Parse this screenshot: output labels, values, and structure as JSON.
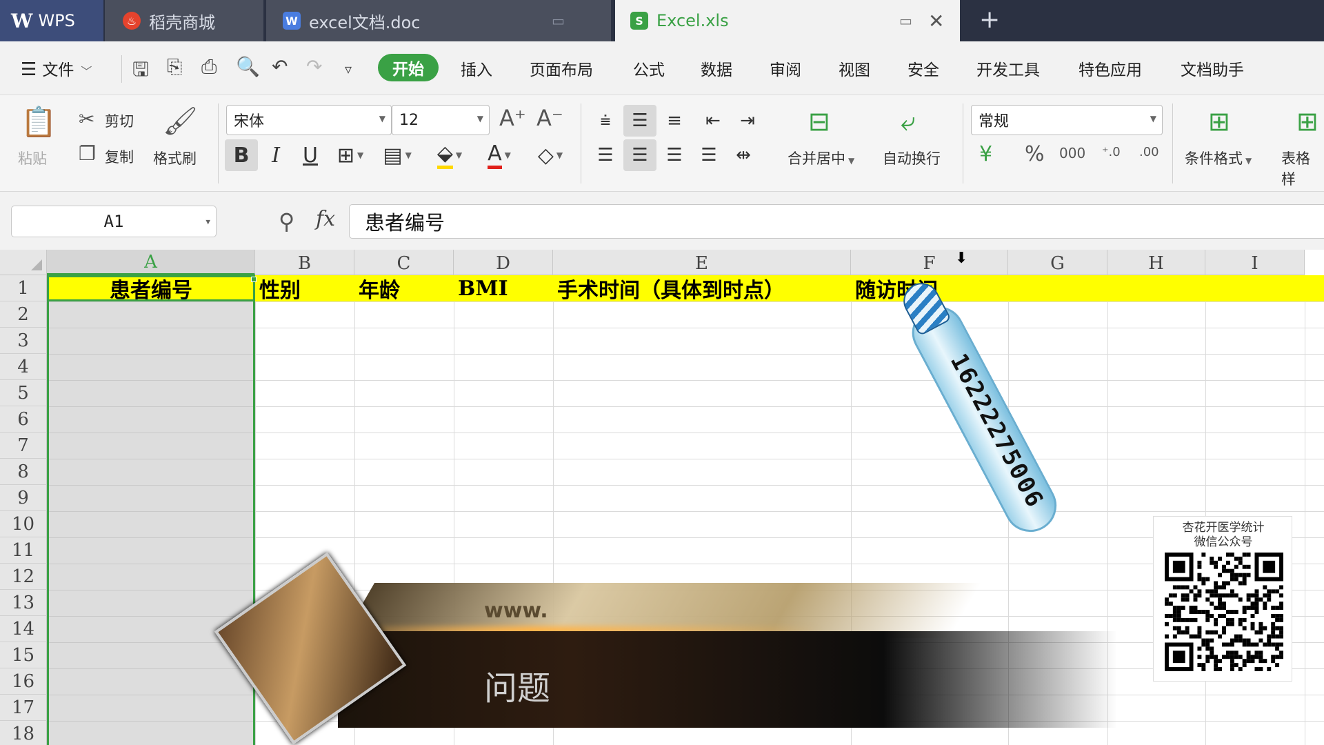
{
  "tabs": {
    "app": "WPS",
    "tab1": "稻壳商城",
    "tab2": "excel文档.doc",
    "tab3": "Excel.xls",
    "add": "+"
  },
  "menu": {
    "file": "文件",
    "items": [
      "开始",
      "插入",
      "页面布局",
      "公式",
      "数据",
      "审阅",
      "视图",
      "安全",
      "开发工具",
      "特色应用",
      "文档助手"
    ]
  },
  "ribbon": {
    "paste": "粘贴",
    "cut": "剪切",
    "copy": "复制",
    "format_painter": "格式刷",
    "font_name": "宋体",
    "font_size": "12",
    "merge_center": "合并居中",
    "wrap_text": "自动换行",
    "number_format": "常规",
    "conditional_format": "条件格式",
    "table_style": "表格样"
  },
  "formula_bar": {
    "name_box": "A1",
    "fx": "fx",
    "value": "患者编号"
  },
  "sheet": {
    "columns": [
      "A",
      "B",
      "C",
      "D",
      "E",
      "F",
      "G",
      "H",
      "I"
    ],
    "rows": [
      "1",
      "2",
      "3",
      "4",
      "5",
      "6",
      "7",
      "8",
      "9",
      "10",
      "11",
      "12",
      "13",
      "14",
      "15",
      "16",
      "17",
      "18"
    ],
    "header_row": [
      "患者编号",
      "性别",
      "年龄",
      "BMI",
      "手术时间（具体到时点）",
      "随访时间"
    ],
    "selected_cell": "A1",
    "highlight_color": "#ffff00",
    "selection_color": "#3aa145"
  },
  "overlay": {
    "pen_number": "16222275006",
    "banner_www": "www.",
    "banner_text": "问题",
    "qr_title_line1": "杏花开医学统计",
    "qr_title_line2": "微信公众号"
  }
}
